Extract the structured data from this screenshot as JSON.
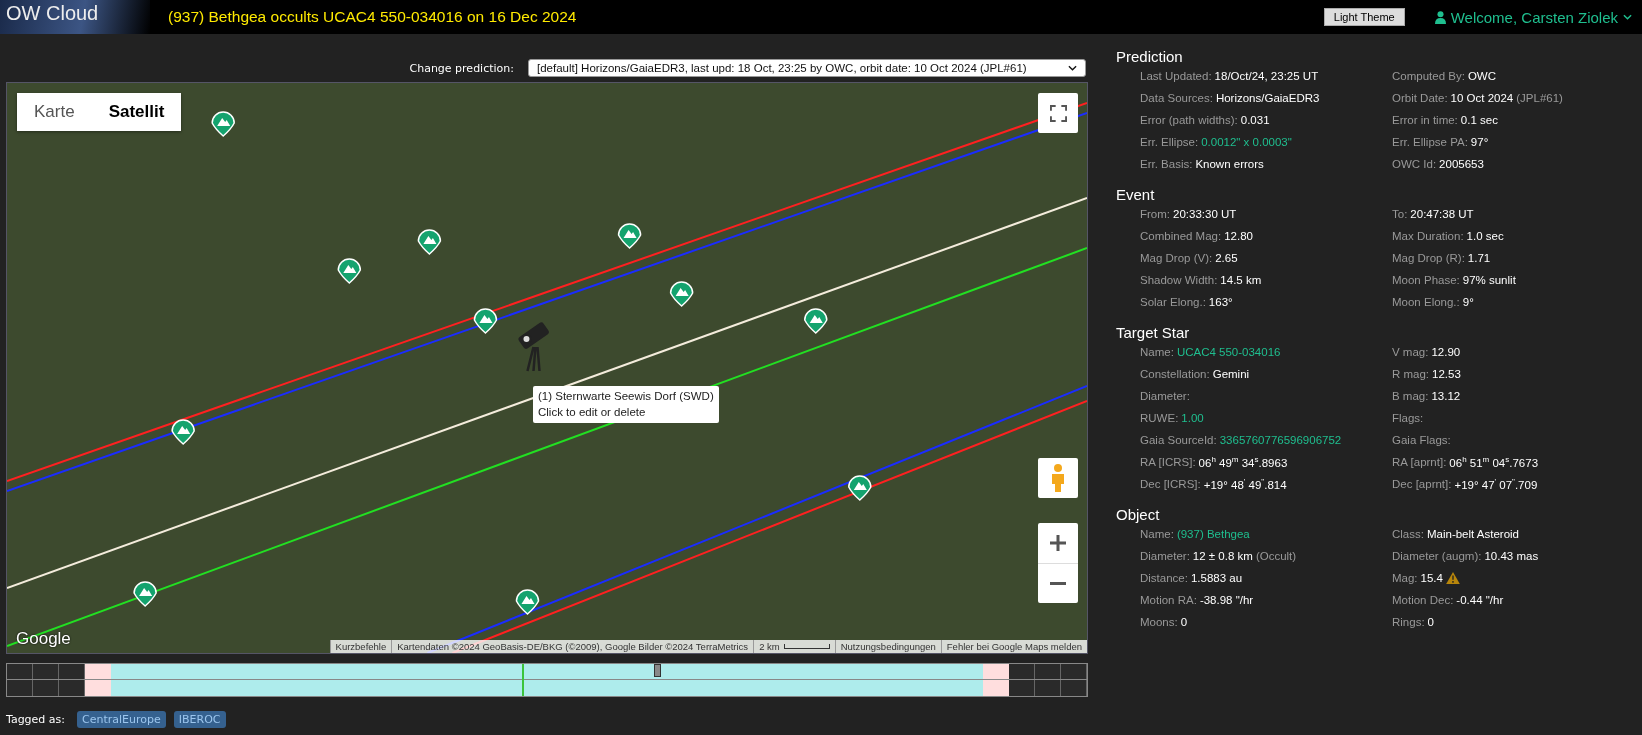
{
  "header": {
    "logo": "OW Cloud",
    "title": "(937) Bethgea occults UCAC4 550-034016 on 16 Dec 2024",
    "theme_button": "Light Theme",
    "user": "Welcome, Carsten Ziolek"
  },
  "prediction_select": {
    "label": "Change prediction:",
    "value": "[default] Horizons/GaiaEDR3, last upd: 18 Oct, 23:25 by OWC, orbit date: 10 Oct 2024 (JPL#61)"
  },
  "map": {
    "map_types": [
      {
        "label": "Karte",
        "selected": false
      },
      {
        "label": "Satellit",
        "selected": true
      }
    ],
    "tooltip": [
      "(1) Sternwarte Seewis Dorf (SWD)",
      "Click to edit or delete"
    ],
    "brand": "Google",
    "attribution": [
      "Kurzbefehle",
      "Kartendaten ©2024 GeoBasis-DE/BKG (©2009), Google Bilder ©2024 TerraMetrics",
      "2 km",
      "Nutzungsbedingungen",
      "Fehler bei Google Maps melden"
    ]
  },
  "tags": {
    "label": "Tagged as:",
    "items": [
      "CentralEurope",
      "IBEROC"
    ]
  },
  "sections": [
    {
      "title": "Prediction",
      "fields": [
        {
          "label": "Last Updated:",
          "value": "18/Oct/24, 23:25 UT",
          "kind": "plain"
        },
        {
          "label": "Computed By:",
          "value": "OWC",
          "kind": "plain"
        },
        {
          "label": "Data Sources:",
          "value": "Horizons/GaiaEDR3",
          "kind": "plain"
        },
        {
          "label": "Orbit Date:",
          "value": "10 Oct 2024",
          "note": "(JPL#61)",
          "kind": "plain"
        },
        {
          "label": "Error (path widths):",
          "value": "0.031",
          "kind": "plain"
        },
        {
          "label": "Error in time:",
          "value": "0.1 sec",
          "kind": "plain"
        },
        {
          "label": "Err. Ellipse:",
          "value": "0.0012\" x 0.0003\"",
          "kind": "link"
        },
        {
          "label": "Err. Ellipse PA:",
          "value": "97°",
          "kind": "plain"
        },
        {
          "label": "Err. Basis:",
          "value": "Known errors",
          "kind": "plain"
        },
        {
          "label": "OWC Id:",
          "value": "2005653",
          "kind": "plain"
        }
      ]
    },
    {
      "title": "Event",
      "fields": [
        {
          "label": "From:",
          "value": "20:33:30 UT",
          "kind": "plain"
        },
        {
          "label": "To:",
          "value": "20:47:38 UT",
          "kind": "plain"
        },
        {
          "label": "Combined Mag:",
          "value": "12.80",
          "kind": "plain"
        },
        {
          "label": "Max Duration:",
          "value": "1.0 sec",
          "kind": "plain"
        },
        {
          "label": "Mag Drop (V):",
          "value": "2.65",
          "kind": "plain"
        },
        {
          "label": "Mag Drop (R):",
          "value": "1.71",
          "kind": "plain"
        },
        {
          "label": "Shadow Width:",
          "value": "14.5 km",
          "kind": "plain"
        },
        {
          "label": "Moon Phase:",
          "value": "97% sunlit",
          "kind": "plain"
        },
        {
          "label": "Solar Elong.:",
          "value": "163°",
          "kind": "plain"
        },
        {
          "label": "Moon Elong.:",
          "value": "9°",
          "kind": "plain"
        }
      ]
    },
    {
      "title": "Target Star",
      "fields": [
        {
          "label": "Name:",
          "value": "UCAC4 550-034016",
          "kind": "link"
        },
        {
          "label": "V mag:",
          "value": "12.90",
          "kind": "plain"
        },
        {
          "label": "Constellation:",
          "value": "Gemini",
          "kind": "plain"
        },
        {
          "label": "R mag:",
          "value": "12.53",
          "kind": "plain"
        },
        {
          "label": "Diameter:",
          "kind": "plain"
        },
        {
          "label": "B mag:",
          "value": "13.12",
          "kind": "plain"
        },
        {
          "label": "RUWE:",
          "value": "1.00",
          "kind": "link"
        },
        {
          "label": "Flags:",
          "kind": "plain"
        },
        {
          "label": "Gaia SourceId:",
          "value": "3365760776596906752",
          "kind": "link"
        },
        {
          "label": "Gaia Flags:",
          "kind": "plain"
        },
        {
          "label": "RA [ICRS]:",
          "value": "06$^{h}$ 49$^{m}$ 34$^{s}$.8963",
          "kind": "plain"
        },
        {
          "label": "RA [aprnt]:",
          "value": "06$^{h}$ 51$^{m}$ 04$^{s}$.7673",
          "kind": "plain"
        },
        {
          "label": "Dec [ICRS]:",
          "value": "+19° 48$^{'}$ 49$^{\"}$.814",
          "kind": "plain"
        },
        {
          "label": "Dec [aprnt]:",
          "value": "+19° 47$^{'}$ 07$^{\"}$.709",
          "kind": "plain"
        }
      ]
    },
    {
      "title": "Object",
      "fields": [
        {
          "label": "Name:",
          "value": "(937) Bethgea",
          "kind": "link"
        },
        {
          "label": "Class:",
          "value": "Main-belt Asteroid",
          "kind": "plain"
        },
        {
          "label": "Diameter:",
          "value": "12 ± 0.8 km",
          "note": "(Occult)",
          "kind": "plain"
        },
        {
          "label": "Diameter (augm):",
          "value": "10.43 mas",
          "kind": "plain"
        },
        {
          "label": "Distance:",
          "value": "1.5883 au",
          "kind": "plain"
        },
        {
          "label": "Mag:",
          "value": "15.4",
          "kind": "warning"
        },
        {
          "label": "Motion RA:",
          "value": "-38.98 \"/hr",
          "kind": "plain"
        },
        {
          "label": "Motion Dec:",
          "value": "-0.44 \"/hr",
          "kind": "plain"
        },
        {
          "label": "Moons:",
          "value": "0",
          "kind": "plain"
        },
        {
          "label": "Rings:",
          "value": "0",
          "kind": "plain"
        }
      ]
    }
  ]
}
